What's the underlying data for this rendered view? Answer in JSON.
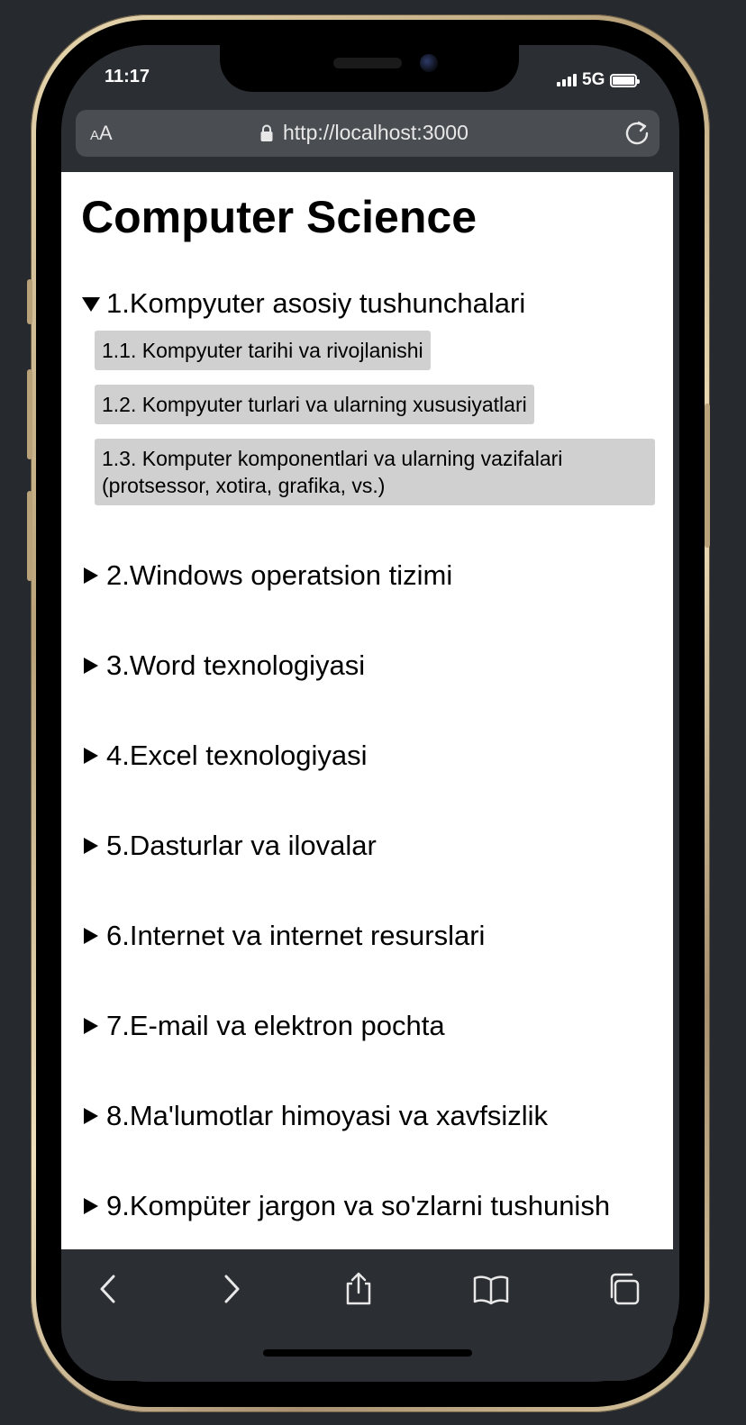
{
  "status_bar": {
    "time": "11:17",
    "network": "5G"
  },
  "browser": {
    "text_size_small": "A",
    "text_size_large": "A",
    "url": "http://localhost:3000"
  },
  "page": {
    "title": "Computer Science",
    "sections": [
      {
        "label": "1.Kompyuter asosiy tushunchalari",
        "expanded": true,
        "items": [
          "1.1. Kompyuter tarihi va rivojlanishi",
          "1.2. Kompyuter turlari va ularning xususiyatlari",
          "1.3. Komputer komponentlari va ularning vazifalari (protsessor, xotira, grafika, vs.)"
        ]
      },
      {
        "label": "2.Windows operatsion tizimi",
        "expanded": false
      },
      {
        "label": "3.Word texnologiyasi",
        "expanded": false
      },
      {
        "label": "4.Excel texnologiyasi",
        "expanded": false
      },
      {
        "label": "5.Dasturlar va ilovalar",
        "expanded": false
      },
      {
        "label": "6.Internet va internet resurslari",
        "expanded": false
      },
      {
        "label": "7.E-mail va elektron pochta",
        "expanded": false
      },
      {
        "label": "8.Ma'lumotlar himoyasi va xavfsizlik",
        "expanded": false
      },
      {
        "label": "9.Kompüter jargon va so'zlarni tushunish",
        "expanded": false
      }
    ]
  },
  "toolbar": {
    "back_icon": "chevron-left-icon",
    "forward_icon": "chevron-right-icon",
    "share_icon": "share-icon",
    "bookmarks_icon": "book-icon",
    "tabs_icon": "tabs-icon"
  }
}
